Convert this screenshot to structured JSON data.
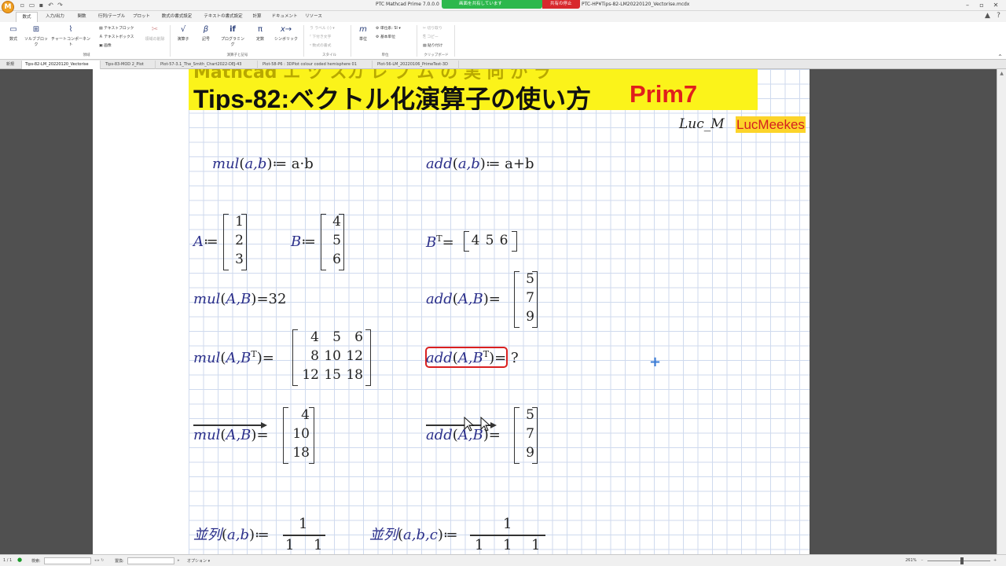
{
  "window": {
    "title": "PTC Mathcad Prime 7.0.0.0",
    "share_status": "画面を共有しています",
    "share_stop": "共有の停止",
    "doc_path": "PTC-HP¥Tips-82-LM20220120_Vectorise.mcdx",
    "logo": "M"
  },
  "ribbon_tabs": [
    "数式",
    "入力/出力",
    "関数",
    "行列/テーブル",
    "プロット",
    "数式の書式設定",
    "テキストの書式設定",
    "計算",
    "ドキュメント",
    "リソース"
  ],
  "ribbon": {
    "items": {
      "math": "数式",
      "solve_block": "ソルブブロック",
      "chart_component": "チャートコンポーネント",
      "text_block": "テキストブロック",
      "text_box": "テキストボックス",
      "image": "画像",
      "remove_area": "領域の削除",
      "operators": "演算子",
      "symbols": "記号",
      "programming": "プログラミング",
      "constants": "定数",
      "symbolic": "シンボリック",
      "label": "ラベル",
      "label_value": "(-)",
      "subscript": "下付き文字",
      "math_format": "数式の書式",
      "units": "単位",
      "unit_system": "単位系:",
      "unit_system_value": "SI",
      "base_units": "基本単位",
      "cut": "切り取り",
      "copy": "コピー",
      "paste": "貼り付け"
    },
    "groups": {
      "areas": "領域",
      "operators_symbols": "演算子と記号",
      "style": "スタイル",
      "units": "単位",
      "clipboard": "クリップボード"
    }
  },
  "doc_tabs": [
    "新規",
    "Tips-82-LM_20220120_Vectorise",
    "Tips-83-MOD 2_Plot",
    "Plot-57-3.1_The_Smith_Chart2022-DEJ-43",
    "Plot-58-P6 : 3DPlot colour coded hemisphere 01",
    "Plot-56-LM_20220106_PrimeTest-3D"
  ],
  "banner": {
    "top_line": "Mathcad エ ヅ スカ レ ブ ム の 実 向 か ラ",
    "title": "Tips-82:ベクトル化演算子の使い方",
    "prim": "Prim7"
  },
  "author": {
    "italic": "Luc_M",
    "tag": "LucMeekes"
  },
  "math": {
    "mul_def_name": "mul",
    "mul_def_args": "a,b",
    "mul_def_body": "≔ a·b",
    "add_def_name": "add",
    "add_def_args": "a,b",
    "add_def_body": "≔ a+b",
    "A_name": "A",
    "A_assign": "≔",
    "A_values": [
      "1",
      "2",
      "3"
    ],
    "B_name": "B",
    "B_assign": "≔",
    "B_values": [
      "4",
      "5",
      "6"
    ],
    "BT_name": "B",
    "BT_sup": "T",
    "BT_eq": "=",
    "BT_values": [
      "4",
      "5",
      "6"
    ],
    "mulAB_name": "mul",
    "mulAB_args": "A,B",
    "mulAB_result": "=32",
    "addAB_name": "add",
    "addAB_args": "A,B",
    "addAB_eq": "=",
    "addAB_values": [
      "5",
      "7",
      "9"
    ],
    "mulABT_name": "mul",
    "mulABT_args": "A,B",
    "mulABT_sup": "T",
    "mulABT_eq": "=",
    "mulABT_values": [
      "4",
      "5",
      "6",
      "8",
      "10",
      "12",
      "12",
      "15",
      "18"
    ],
    "addABT_name": "add",
    "addABT_args": "A,B",
    "addABT_sup": "T",
    "addABT_result": "= ?",
    "vmul_name": "mul",
    "vmul_args": "A,B",
    "vmul_eq": "=",
    "vmul_values": [
      "4",
      "10",
      "18"
    ],
    "vadd_name": "add",
    "vadd_args": "A,B",
    "vadd_eq": "=",
    "vadd_values": [
      "5",
      "7",
      "9"
    ],
    "par2_name": "並列",
    "par2_args": "a,b",
    "par2_assign": "≔",
    "par2_num": "1",
    "par2_den": [
      "1",
      "1"
    ],
    "par3_name": "並列",
    "par3_args": "a,b,c",
    "par3_assign": "≔",
    "par3_num": "1",
    "par3_den": [
      "1",
      "1",
      "1"
    ]
  },
  "status": {
    "page": "1 / 1",
    "search_label": "検索:",
    "replace_label": "置換:",
    "options": "オプション",
    "zoom": "261%"
  }
}
